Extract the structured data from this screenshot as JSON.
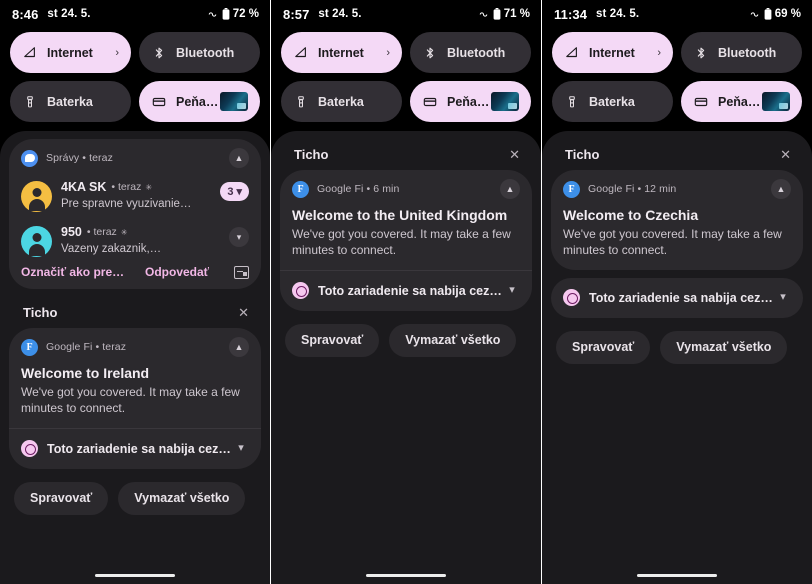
{
  "panels": [
    {
      "status": {
        "time": "8:46",
        "date": "st 24. 5.",
        "battery": "72 %",
        "net_icon": "infinity-data-icon",
        "battery_icon": "battery-icon"
      },
      "tiles": [
        {
          "label": "Internet",
          "icon": "wifi-icon",
          "state": "active",
          "chevron": "›"
        },
        {
          "label": "Bluetooth",
          "icon": "bluetooth-icon",
          "state": "dark"
        },
        {
          "label": "Baterka",
          "icon": "flashlight-icon",
          "state": "dark"
        },
        {
          "label": "Peňaže..",
          "icon": "wallet-icon",
          "state": "active",
          "thumb": "payment-card-thumbnail"
        }
      ],
      "messages_group": {
        "app": "Správy • teraz",
        "app_icon": "messages-icon",
        "collapse_icon": "chevron-up-icon",
        "items": [
          {
            "sender": "4KA SK",
            "meta": "• teraz",
            "star": "✳",
            "preview": "Pre spravne vyuzivanie…",
            "badge": "3",
            "badge_icon": "chevron-down-icon",
            "avatar": "amber"
          },
          {
            "sender": "950",
            "meta": "• teraz",
            "star": "✳",
            "preview": "Vazeny zakaznik,…",
            "expand_icon": "chevron-down-icon",
            "avatar": "cyan"
          }
        ],
        "actions": [
          "Označiť ako prečít…",
          "Odpovedať"
        ],
        "reply_icon": "inline-reply-icon"
      },
      "silent": {
        "title": "Ticho",
        "close_icon": "close-icon",
        "fi": {
          "app": "Google Fi • teraz",
          "app_icon": "google-fi-icon",
          "collapse_icon": "chevron-up-icon",
          "title": "Welcome to Ireland",
          "text": "We've got you covered. It may take a few minutes to connect."
        },
        "system": {
          "icon": "system-settings-icon",
          "text": "Toto zariadenie sa nabija cez…",
          "expand_icon": "chevron-down-icon"
        }
      },
      "buttons": {
        "manage": "Spravovať",
        "clear": "Vymazať všetko"
      }
    },
    {
      "status": {
        "time": "8:57",
        "date": "st 24. 5.",
        "battery": "71 %",
        "net_icon": "infinity-data-icon",
        "battery_icon": "battery-icon"
      },
      "tiles": [
        {
          "label": "Internet",
          "icon": "wifi-icon",
          "state": "active",
          "chevron": "›"
        },
        {
          "label": "Bluetooth",
          "icon": "bluetooth-icon",
          "state": "dark"
        },
        {
          "label": "Baterka",
          "icon": "flashlight-icon",
          "state": "dark"
        },
        {
          "label": "Peňaže..",
          "icon": "wallet-icon",
          "state": "active",
          "thumb": "payment-card-thumbnail"
        }
      ],
      "silent": {
        "title": "Ticho",
        "close_icon": "close-icon",
        "fi": {
          "app": "Google Fi • 6 min",
          "app_icon": "google-fi-icon",
          "collapse_icon": "chevron-up-icon",
          "title": "Welcome to the United Kingdom",
          "text": "We've got you covered. It may take a few minutes to connect."
        },
        "system": {
          "icon": "system-settings-icon",
          "text": "Toto zariadenie sa nabija cez…",
          "expand_icon": "chevron-down-icon"
        }
      },
      "buttons": {
        "manage": "Spravovať",
        "clear": "Vymazať všetko"
      }
    },
    {
      "status": {
        "time": "11:34",
        "date": "st 24. 5.",
        "battery": "69 %",
        "net_icon": "infinity-data-icon",
        "battery_icon": "battery-icon"
      },
      "tiles": [
        {
          "label": "Internet",
          "icon": "wifi-icon",
          "state": "active",
          "chevron": "›"
        },
        {
          "label": "Bluetooth",
          "icon": "bluetooth-icon",
          "state": "dark"
        },
        {
          "label": "Baterka",
          "icon": "flashlight-icon",
          "state": "dark"
        },
        {
          "label": "Peňaže..",
          "icon": "wallet-icon",
          "state": "active",
          "thumb": "payment-card-thumbnail"
        }
      ],
      "silent": {
        "title": "Ticho",
        "close_icon": "close-icon",
        "fi": {
          "app": "Google Fi • 12 min",
          "app_icon": "google-fi-icon",
          "collapse_icon": "chevron-up-icon",
          "title": "Welcome to Czechia",
          "text": "We've got you covered. It may take a few minutes to connect."
        },
        "system": {
          "icon": "system-settings-icon",
          "text": "Toto zariadenie sa nabija cez…",
          "expand_icon": "chevron-down-icon"
        }
      },
      "buttons": {
        "manage": "Spravovať",
        "clear": "Vymazať všetko"
      }
    }
  ],
  "colors": {
    "background": "#000000",
    "shade": "#1B1A1D",
    "card": "#2B292D",
    "tile_active": "#F4D9F6",
    "tile_dark": "#322F35",
    "accent_pink": "#F2B7E6",
    "avatar_amber": "#F5BE42",
    "avatar_cyan": "#4CD6E3",
    "fi_blue": "#3D8FE8"
  }
}
